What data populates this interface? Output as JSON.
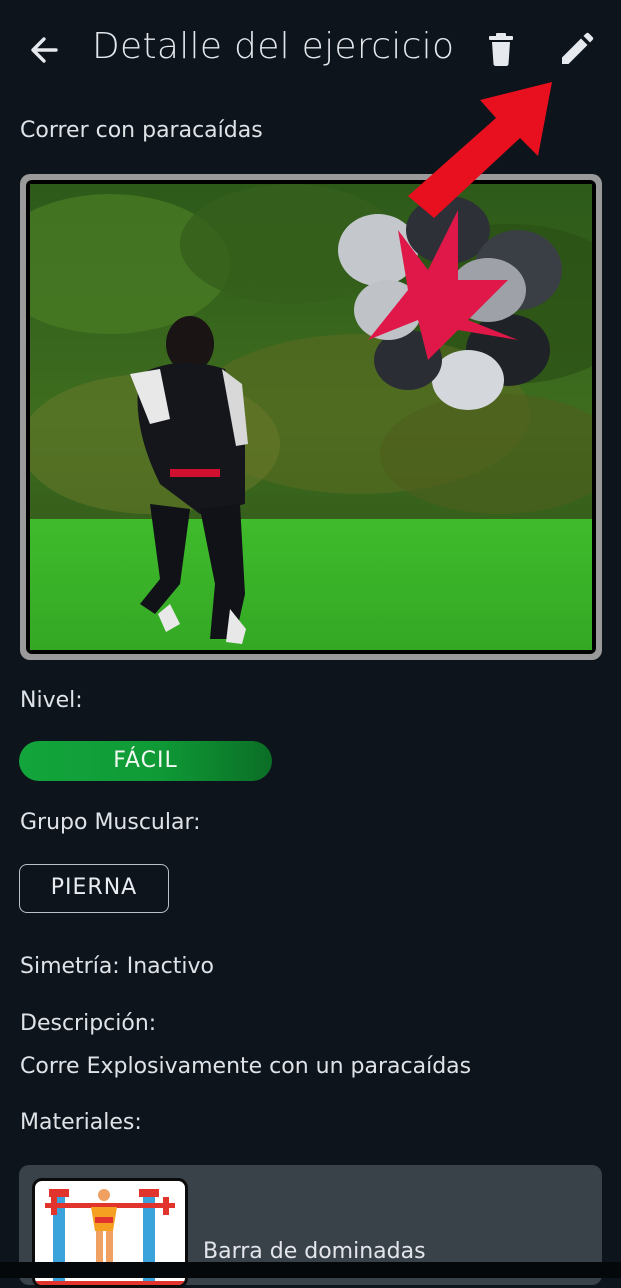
{
  "header": {
    "title": "Detalle del ejercicio",
    "back_icon": "arrow-left-icon",
    "delete_icon": "trash-icon",
    "edit_icon": "pencil-icon"
  },
  "exercise": {
    "name": "Correr con paracaídas",
    "level_label": "Nivel:",
    "level_value": "FÁCIL",
    "muscle_group_label": "Grupo Muscular:",
    "muscle_group_value": "PIERNA",
    "symmetry_text": "Simetría: Inactivo",
    "description_label": "Descripción:",
    "description_text": "Corre Explosivamente con un paracaídas",
    "materials_label": "Materiales:"
  },
  "materials": [
    {
      "name": "Barra de dominadas"
    }
  ],
  "colors": {
    "background": "#0d141b",
    "level_pill": "#13a53c",
    "card": "#394149",
    "annotation_arrow": "#e8101e"
  }
}
